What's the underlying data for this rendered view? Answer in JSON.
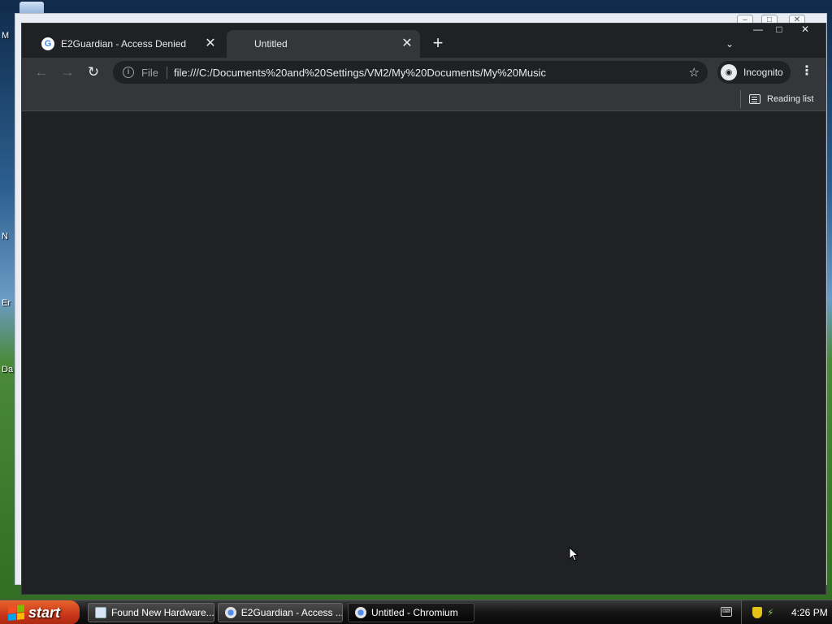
{
  "desktop": {
    "icon_labels": [
      "M",
      "N",
      "Er",
      "Da"
    ]
  },
  "browser": {
    "tabs": [
      {
        "title": "E2Guardian - Access Denied",
        "favicon": "google-g-icon",
        "active": false
      },
      {
        "title": "Untitled",
        "favicon": "none",
        "active": true
      }
    ],
    "new_tab": "+",
    "tab_search": "⌄",
    "window_controls": {
      "minimize": "—",
      "maximize": "□",
      "close": "✕"
    },
    "nav": {
      "back": "←",
      "forward": "→",
      "reload": "↻"
    },
    "omnibox": {
      "scheme_chip": "File",
      "url": "file:///C:/Documents%20and%20Settings/VM2/My%20Documents/My%20Music",
      "bookmark_star": "☆"
    },
    "profile": {
      "label": "Incognito"
    },
    "menu": "⋮",
    "bookmark_bar": {
      "reading_list": "Reading list"
    }
  },
  "taskbar": {
    "start_label": "start",
    "tasks": [
      {
        "label": "Found New Hardware...",
        "icon": "hardware-wizard-icon"
      },
      {
        "label": "E2Guardian - Access ...",
        "icon": "chromium-icon"
      },
      {
        "label": "Untitled - Chromium",
        "icon": "chromium-icon",
        "active": true
      }
    ],
    "clock": "4:26 PM"
  },
  "colors": {
    "chrome_dark": "#202124",
    "toolbar": "#35363a",
    "text": "#e8eaed",
    "start_orange": "#c8361a"
  }
}
